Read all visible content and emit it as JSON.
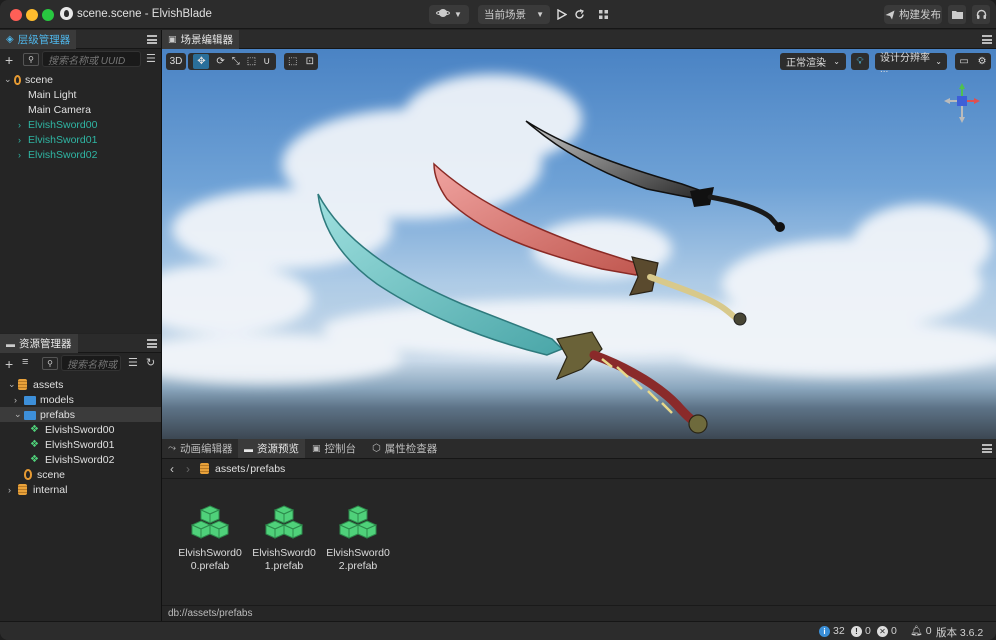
{
  "window": {
    "title": "scene.scene - ElvishBlade"
  },
  "toolbar": {
    "scene_select_label": "当前场景",
    "build_label": "构建发布"
  },
  "hierarchy": {
    "title": "层级管理器",
    "search_placeholder": "搜索名称或 UUID",
    "items": [
      {
        "label": "scene"
      },
      {
        "label": "Main Light"
      },
      {
        "label": "Main Camera"
      },
      {
        "label": "ElvishSword00"
      },
      {
        "label": "ElvishSword01"
      },
      {
        "label": "ElvishSword02"
      }
    ]
  },
  "assets_panel": {
    "title": "资源管理器",
    "search_placeholder": "搜索名称或",
    "items": [
      {
        "label": "assets"
      },
      {
        "label": "models"
      },
      {
        "label": "prefabs"
      },
      {
        "label": "ElvishSword00"
      },
      {
        "label": "ElvishSword01"
      },
      {
        "label": "ElvishSword02"
      },
      {
        "label": "scene"
      },
      {
        "label": "internal"
      }
    ]
  },
  "scene_editor": {
    "title": "场景编辑器",
    "mode_3d": "3D",
    "render_mode": "正常渲染",
    "resolution": "设计分辨率 ..."
  },
  "bottom_tabs": [
    {
      "label": "动画编辑器"
    },
    {
      "label": "资源预览"
    },
    {
      "label": "控制台"
    },
    {
      "label": "属性检查器"
    }
  ],
  "preview": {
    "breadcrumb_root": "assets",
    "breadcrumb_sep": "/",
    "breadcrumb_leaf": "prefabs",
    "path": "db://assets/prefabs",
    "files": [
      {
        "line1": "ElvishSword0",
        "line2": "0.prefab"
      },
      {
        "line1": "ElvishSword0",
        "line2": "1.prefab"
      },
      {
        "line1": "ElvishSword0",
        "line2": "2.prefab"
      }
    ]
  },
  "status": {
    "info_count": "32",
    "warn_count": "0",
    "error_count": "0",
    "notify_count": "0",
    "version": "版本 3.6.2"
  },
  "colors": {
    "accent": "#2fb5a3",
    "prefab_icon": "#4fd17a",
    "folder": "#3d8fd9"
  }
}
